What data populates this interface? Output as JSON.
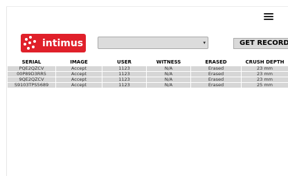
{
  "header": {
    "menu_icon": "hamburger-menu-icon",
    "logo_text": "intimus",
    "brand_color": "#e0202a"
  },
  "controls": {
    "select_value": "",
    "get_record_label": "GET RECORD"
  },
  "table": {
    "headers": [
      "SERIAL",
      "IMAGE",
      "USER",
      "WITNESS",
      "ERASED",
      "CRUSH DEPTH"
    ],
    "rows": [
      [
        "PQE2QZCV",
        "Accept",
        "1123",
        "N/A",
        "Erased",
        "23 mm"
      ],
      [
        "00P89D3RR5",
        "Accept",
        "1123",
        "N/A",
        "Erased",
        "23 mm"
      ],
      [
        "9QE2QZCV",
        "Accept",
        "1123",
        "N/A",
        "Erased",
        "23 mm"
      ],
      [
        "S9103TPS5689",
        "Accept",
        "1123",
        "N/A",
        "Erased",
        "25 mm"
      ]
    ]
  }
}
